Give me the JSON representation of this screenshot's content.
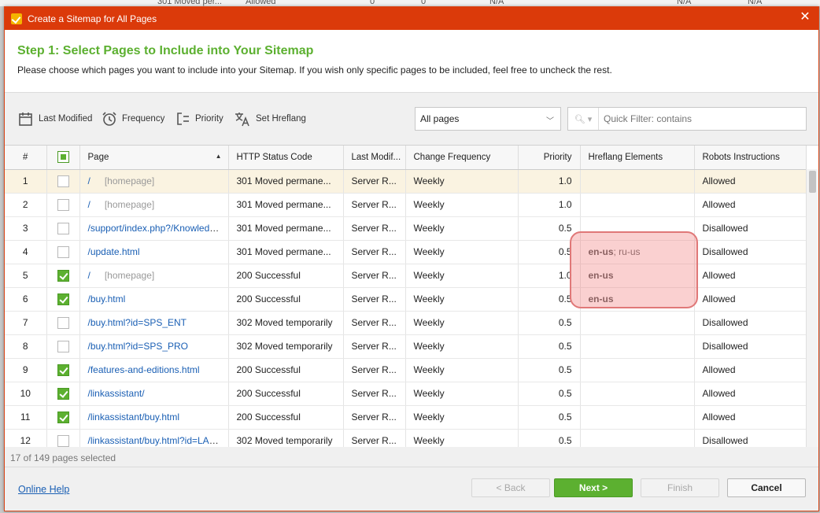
{
  "background": {
    "status": "301 Moved per...",
    "robots": "Allowed",
    "zero1": "0",
    "zero2": "0",
    "na1": "N/A",
    "na2": "N/A",
    "na3": "N/A"
  },
  "window": {
    "title": "Create a Sitemap for All Pages",
    "accent_color": "#db3a0a"
  },
  "step": {
    "title": "Step 1: Select Pages to Include into Your Sitemap",
    "description": "Please choose which pages you want to include into your Sitemap. If you wish only specific pages to be included, feel free to uncheck the rest.",
    "title_color": "#5cb030"
  },
  "toolbar": {
    "last_modified": "Last Modified",
    "frequency": "Frequency",
    "priority": "Priority",
    "hreflang": "Set Hreflang",
    "page_filter": "All pages",
    "quick_filter_placeholder": "Quick Filter: contains"
  },
  "table": {
    "columns": {
      "num": "#",
      "page": "Page",
      "status": "HTTP Status Code",
      "modified": "Last Modif...",
      "frequency": "Change Frequency",
      "priority": "Priority",
      "hreflang": "Hreflang Elements",
      "robots": "Robots Instructions"
    },
    "header_checkbox": "partial",
    "rows": [
      {
        "num": "1",
        "checked": false,
        "page": "/",
        "tag": "[homepage]",
        "status": "301 Moved permane...",
        "modified": "Server R...",
        "frequency": "Weekly",
        "priority": "1.0",
        "href_bold": "",
        "href_rest": "",
        "robots": "Allowed",
        "selected": true
      },
      {
        "num": "2",
        "checked": false,
        "page": "/",
        "tag": "[homepage]",
        "status": "301 Moved permane...",
        "modified": "Server R...",
        "frequency": "Weekly",
        "priority": "1.0",
        "href_bold": "",
        "href_rest": "",
        "robots": "Allowed",
        "selected": false
      },
      {
        "num": "3",
        "checked": false,
        "page": "/support/index.php?/Knowledgeb",
        "tag": "",
        "status": "301 Moved permane...",
        "modified": "Server R...",
        "frequency": "Weekly",
        "priority": "0.5",
        "href_bold": "",
        "href_rest": "",
        "robots": "Disallowed",
        "selected": false
      },
      {
        "num": "4",
        "checked": false,
        "page": "/update.html",
        "tag": "",
        "status": "301 Moved permane...",
        "modified": "Server R...",
        "frequency": "Weekly",
        "priority": "0.5",
        "href_bold": "en-us",
        "href_rest": "; ru-us",
        "robots": "Disallowed",
        "selected": false
      },
      {
        "num": "5",
        "checked": true,
        "page": "/",
        "tag": "[homepage]",
        "status": "200 Successful",
        "modified": "Server R...",
        "frequency": "Weekly",
        "priority": "1.0",
        "href_bold": "en-us",
        "href_rest": "",
        "robots": "Allowed",
        "selected": false
      },
      {
        "num": "6",
        "checked": true,
        "page": "/buy.html",
        "tag": "",
        "status": "200 Successful",
        "modified": "Server R...",
        "frequency": "Weekly",
        "priority": "0.5",
        "href_bold": "en-us",
        "href_rest": "",
        "robots": "Allowed",
        "selected": false
      },
      {
        "num": "7",
        "checked": false,
        "page": "/buy.html?id=SPS_ENT",
        "tag": "",
        "status": "302 Moved temporarily",
        "modified": "Server R...",
        "frequency": "Weekly",
        "priority": "0.5",
        "href_bold": "",
        "href_rest": "",
        "robots": "Disallowed",
        "selected": false
      },
      {
        "num": "8",
        "checked": false,
        "page": "/buy.html?id=SPS_PRO",
        "tag": "",
        "status": "302 Moved temporarily",
        "modified": "Server R...",
        "frequency": "Weekly",
        "priority": "0.5",
        "href_bold": "",
        "href_rest": "",
        "robots": "Disallowed",
        "selected": false
      },
      {
        "num": "9",
        "checked": true,
        "page": "/features-and-editions.html",
        "tag": "",
        "status": "200 Successful",
        "modified": "Server R...",
        "frequency": "Weekly",
        "priority": "0.5",
        "href_bold": "",
        "href_rest": "",
        "robots": "Allowed",
        "selected": false
      },
      {
        "num": "10",
        "checked": true,
        "page": "/linkassistant/",
        "tag": "",
        "status": "200 Successful",
        "modified": "Server R...",
        "frequency": "Weekly",
        "priority": "0.5",
        "href_bold": "",
        "href_rest": "",
        "robots": "Allowed",
        "selected": false
      },
      {
        "num": "11",
        "checked": true,
        "page": "/linkassistant/buy.html",
        "tag": "",
        "status": "200 Successful",
        "modified": "Server R...",
        "frequency": "Weekly",
        "priority": "0.5",
        "href_bold": "",
        "href_rest": "",
        "robots": "Allowed",
        "selected": false
      },
      {
        "num": "12",
        "checked": false,
        "page": "/linkassistant/buy.html?id=LA_...",
        "tag": "",
        "status": "302 Moved temporarily",
        "modified": "Server R...",
        "frequency": "Weekly",
        "priority": "0.5",
        "href_bold": "",
        "href_rest": "",
        "robots": "Disallowed",
        "selected": false
      }
    ]
  },
  "selection_count": "17 of 149 pages selected",
  "footer": {
    "help": "Online Help",
    "back": "< Back",
    "next": "Next >",
    "finish": "Finish",
    "cancel": "Cancel"
  }
}
